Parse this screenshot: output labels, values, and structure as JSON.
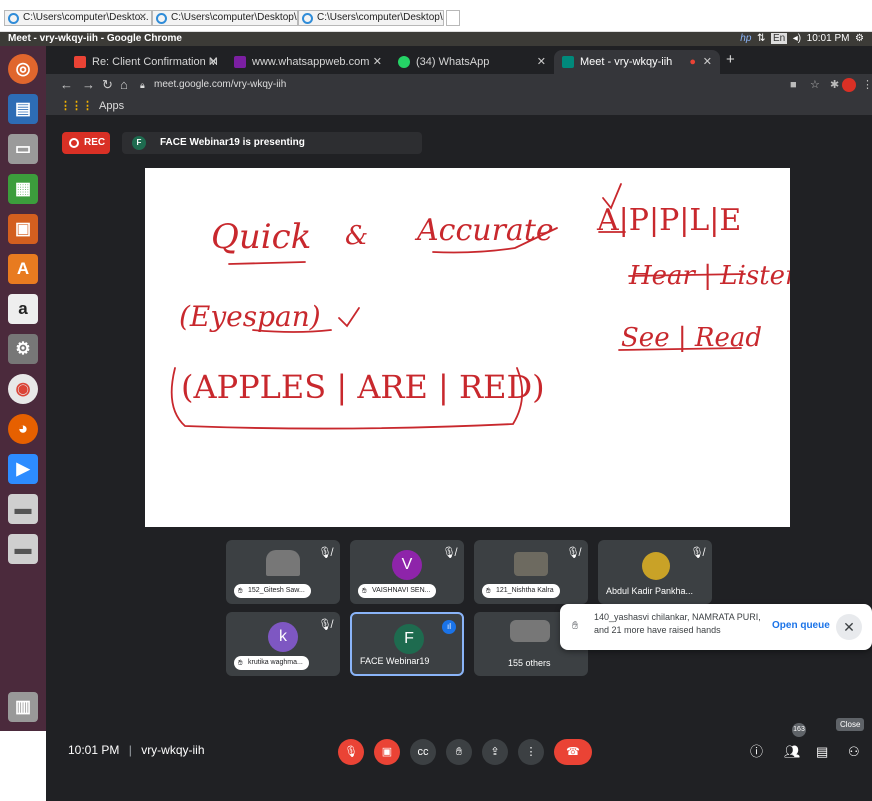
{
  "windows_tabs": [
    {
      "label": "C:\\Users\\computer\\Deskto..."
    },
    {
      "label": "C:\\Users\\computer\\Desktop\\C..."
    },
    {
      "label": "C:\\Users\\computer\\Desktop\\C..."
    }
  ],
  "ubuntu_bar": {
    "title": "Meet - vry-wkqy-iih - Google Chrome",
    "lang": "En",
    "time": "10:01 PM"
  },
  "browser": {
    "tabs": [
      {
        "label": "Re: Client Confirmation M",
        "icon": "gmail-icon"
      },
      {
        "label": "www.whatsappweb.com",
        "icon": "whatsapp-web-icon"
      },
      {
        "label": "(34) WhatsApp",
        "icon": "whatsapp-icon"
      },
      {
        "label": "Meet - vry-wkqy-iih",
        "icon": "meet-icon",
        "active": true
      }
    ],
    "url": "meet.google.com/vry-wkqy-iih",
    "bookmarks_label": "Apps"
  },
  "meet": {
    "rec_label": "REC",
    "presenter_initial": "F",
    "presenting_text": "FACE Webinar19 is presenting",
    "whiteboard": {
      "line1_left": "Quick",
      "line1_mid": "&",
      "line1_right": "Accurate",
      "line2": "(Eyespan)",
      "line3": "(APPLES | ARE | RED)",
      "right1": "A|P|P|L|E",
      "right2": "Hear | Listen",
      "right3": "See | Read"
    },
    "tiles_row1": [
      {
        "name": "152_Gitesh Saw...",
        "hand": true
      },
      {
        "name": "VAISHNAVI SEN...",
        "hand": true,
        "avatar": "V"
      },
      {
        "name": "121_Nishtha Kalra",
        "hand": true
      },
      {
        "name": "Abdul Kadir Pankha...",
        "hand": false
      }
    ],
    "tiles_row2": [
      {
        "name": "krutika waghma...",
        "hand": true,
        "avatar": "k"
      },
      {
        "name": "FACE Webinar19",
        "avatar": "F"
      },
      {
        "name": "155 others"
      }
    ],
    "toast": {
      "message": "140_yashasvi chilankar, NAMRATA PURI, and 21 more have raised hands",
      "action": "Open queue",
      "tooltip": "Close"
    },
    "bottom": {
      "time": "10:01 PM",
      "separator": "|",
      "code": "vry-wkqy-iih",
      "people_count": "163"
    }
  },
  "colors": {
    "meet_bg": "#202124",
    "red": "#ea4335",
    "launcher": "#4b2a3c",
    "ink": "#c8282d"
  }
}
